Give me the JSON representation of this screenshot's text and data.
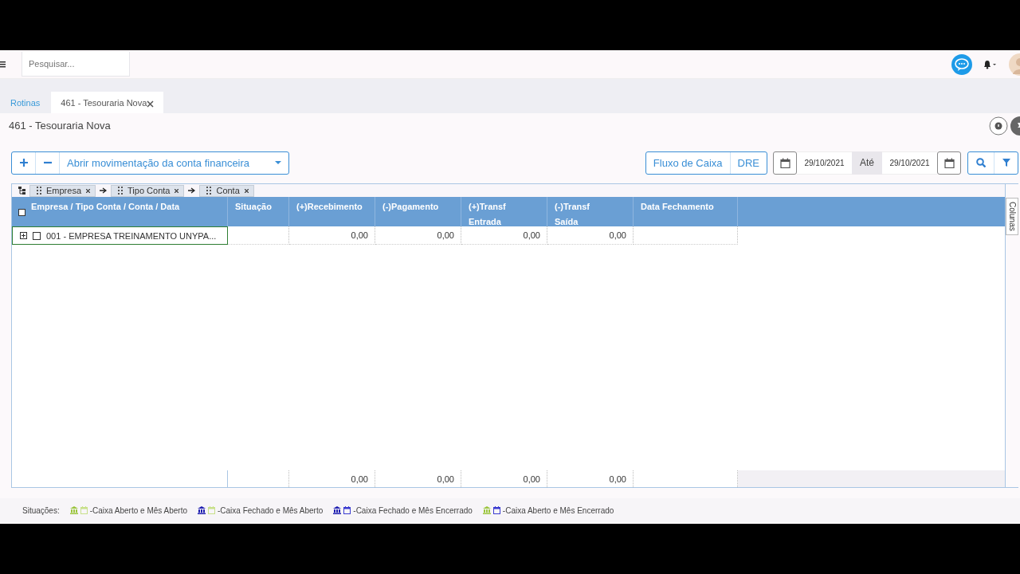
{
  "search": {
    "placeholder": "Pesquisar..."
  },
  "tabs": [
    {
      "label": "Rotinas",
      "selected": false,
      "closable": false
    },
    {
      "label": "461 - Tesouraria Nova",
      "selected": true,
      "closable": true
    }
  ],
  "page_title": "461 - Tesouraria Nova",
  "toolbar": {
    "action": "Abrir movimentação da conta financeira",
    "report_buttons": [
      "Fluxo de Caixa",
      "DRE"
    ],
    "date_from": "29/10/2021",
    "until_label": "Até",
    "date_to": "29/10/2021"
  },
  "grouping": [
    {
      "label": "Empresa"
    },
    {
      "label": "Tipo Conta"
    },
    {
      "label": "Conta"
    }
  ],
  "table": {
    "all_checked": false,
    "columns": [
      {
        "label": "Empresa / Tipo Conta / Conta / Data",
        "kind": "tree"
      },
      {
        "label": "Situação",
        "kind": "status"
      },
      {
        "label": "(+)Recebimento",
        "kind": "amount"
      },
      {
        "label": "(-)Pagamento",
        "kind": "amount"
      },
      {
        "label": "(+)Transf\nEntrada",
        "kind": "amount"
      },
      {
        "label": "(-)Transf\nSaída",
        "kind": "amount"
      },
      {
        "label": "Data Fechamento",
        "kind": "date"
      }
    ],
    "rows": [
      {
        "label": "001 - EMPRESA TREINAMENTO UNYPA...",
        "expanded": false,
        "checked": false,
        "selected": true,
        "amounts": [
          "0,00",
          "0,00",
          "0,00",
          "0,00"
        ]
      }
    ],
    "totals": [
      "0,00",
      "0,00",
      "0,00",
      "0,00"
    ]
  },
  "columns_panel": "Colunas",
  "legend": {
    "label": "Situações:",
    "items": [
      {
        "label": "-Caixa Aberto e Mês Aberto",
        "icons": [
          {
            "kind": "bank",
            "color": "#9bc53d"
          },
          {
            "kind": "calendar",
            "color": "#c8e08a"
          }
        ]
      },
      {
        "label": "-Caixa Fechado e Mês Aberto",
        "icons": [
          {
            "kind": "bank",
            "color": "#1f1fb0"
          },
          {
            "kind": "calendar",
            "color": "#c8e08a"
          }
        ]
      },
      {
        "label": "-Caixa Fechado e Mês Encerrado",
        "icons": [
          {
            "kind": "bank",
            "color": "#1f1fb0"
          },
          {
            "kind": "calendar",
            "color": "#3b3bd0"
          }
        ]
      },
      {
        "label": "-Caixa Aberto e Mês Encerrado",
        "icons": [
          {
            "kind": "bank",
            "color": "#9bc53d"
          },
          {
            "kind": "calendar",
            "color": "#3b3bd0"
          }
        ]
      }
    ]
  }
}
